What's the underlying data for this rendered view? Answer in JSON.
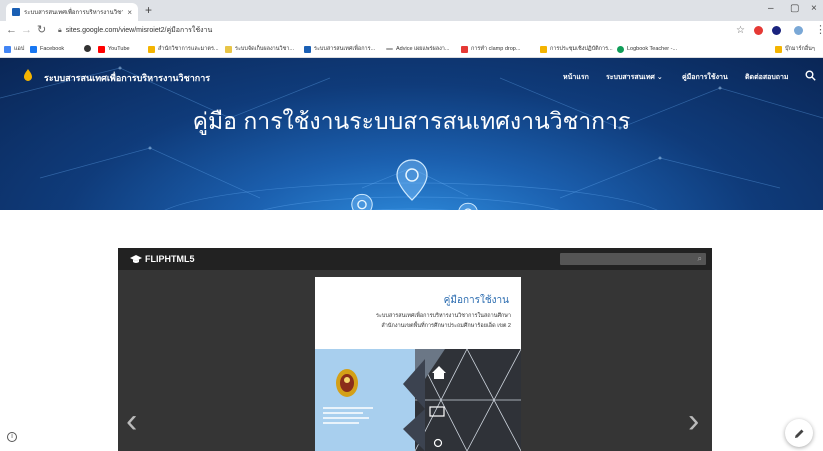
{
  "browser": {
    "tab_title": "ระบบสารสนเทศเพื่อการบริหารงานวิชาการ",
    "tab_close": "×",
    "new_tab": "+",
    "win_minimize": "–",
    "win_maximize": "▢",
    "win_close": "×",
    "url": "sites.google.com/view/misroiet2/คู่มือการใช้งาน",
    "bookmarks": [
      {
        "label": "แอป",
        "color": "#4285f4"
      },
      {
        "label": "Facebook",
        "color": "#1877f2"
      },
      {
        "label": "",
        "color": "#333333"
      },
      {
        "label": "YouTube",
        "color": "#ff0000"
      },
      {
        "label": "สำนักวิชาการและมาตร...",
        "color": "#f4b400"
      },
      {
        "label": "ระบบจัดเก็บผลงานวิชา...",
        "color": "#e8c547"
      },
      {
        "label": "ระบบสารสนเทศเพื่อการ...",
        "color": "#1a5fb4"
      },
      {
        "label": "Advice เผยแพร่ผลงา...",
        "color": "#aaaaaa"
      },
      {
        "label": "การทำ clamp drop...",
        "color": "#e53935"
      },
      {
        "label": "การประชุมเชิงปฏิบัติการ...",
        "color": "#f4b400"
      },
      {
        "label": "Logbook Teacher -...",
        "color": "#0f9d58"
      }
    ],
    "other_bookmarks": "บุ๊กมาร์กอื่นๆ"
  },
  "site": {
    "name": "ระบบสารสนเทศเพื่อการบริหารงานวิชาการ",
    "nav": [
      "หน้าแรก",
      "ระบบสารสนเทศ ⌄",
      "คู่มือการใช้งาน",
      "ติดต่อสอบถาม"
    ],
    "hero_title": "คู่มือ การใช้งานระบบสารสนเทศงานวิชาการ"
  },
  "embed": {
    "brand": "FLIPHTML5",
    "prev": "‹",
    "next": "›",
    "book_title": "คู่มือการใช้งาน",
    "book_sub1": "ระบบสารสนเทศเพื่อการบริหารงานวิชาการในสถานศึกษา",
    "book_sub2": "สำนักงานเขตพื้นที่การศึกษาประถมศึกษาร้อยเอ็ด เขต 2"
  },
  "footer": {
    "info": "i"
  },
  "colors": {
    "hero": "#0f3b7a",
    "accent": "#2b6cb0"
  }
}
